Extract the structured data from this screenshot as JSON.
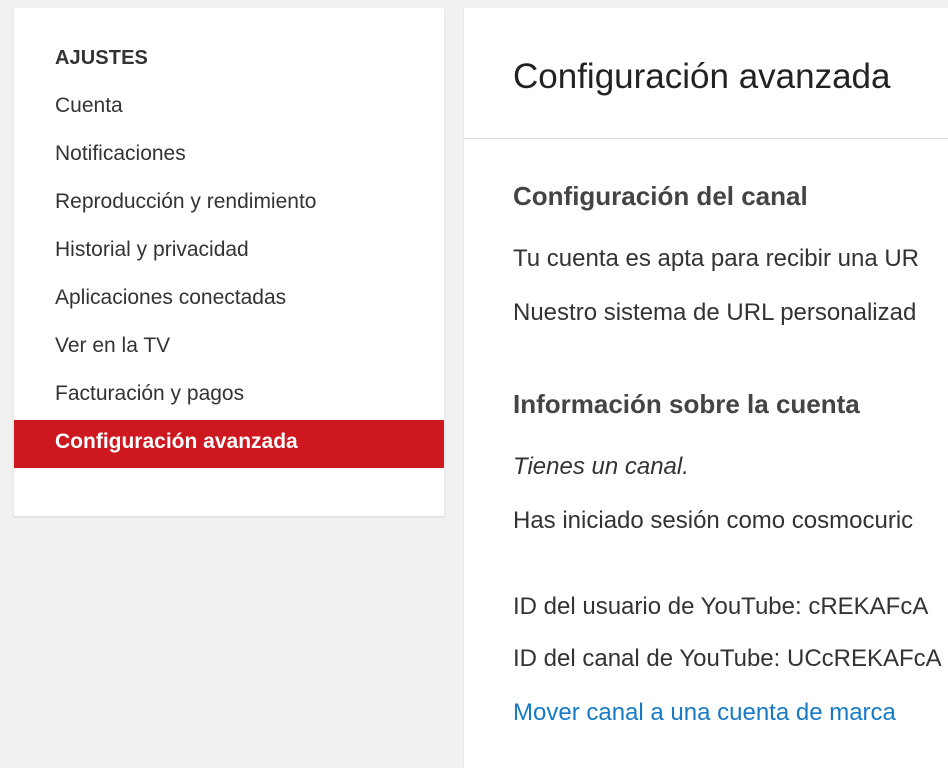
{
  "sidebar": {
    "heading": "AJUSTES",
    "items": [
      {
        "label": "Cuenta"
      },
      {
        "label": "Notificaciones"
      },
      {
        "label": "Reproducción y rendimiento"
      },
      {
        "label": "Historial y privacidad"
      },
      {
        "label": "Aplicaciones conectadas"
      },
      {
        "label": "Ver en la TV"
      },
      {
        "label": "Facturación y pagos"
      },
      {
        "label": "Configuración avanzada"
      }
    ],
    "active_color": "#cc181e"
  },
  "main": {
    "title": "Configuración avanzada",
    "channel_section": {
      "title": "Configuración del canal",
      "line1": "Tu cuenta es apta para recibir una UR",
      "line2": "Nuestro sistema de URL personalizad"
    },
    "account_section": {
      "title": "Información sobre la cuenta",
      "has_channel": "Tienes un canal.",
      "signed_in_as": "Has iniciado sesión como cosmocuric",
      "user_id": "ID del usuario de YouTube: cREKAFcA",
      "channel_id": "ID del canal de YouTube: UCcREKAFcA",
      "move_link": "Mover canal a una cuenta de marca"
    },
    "link_color": "#167ac6"
  }
}
